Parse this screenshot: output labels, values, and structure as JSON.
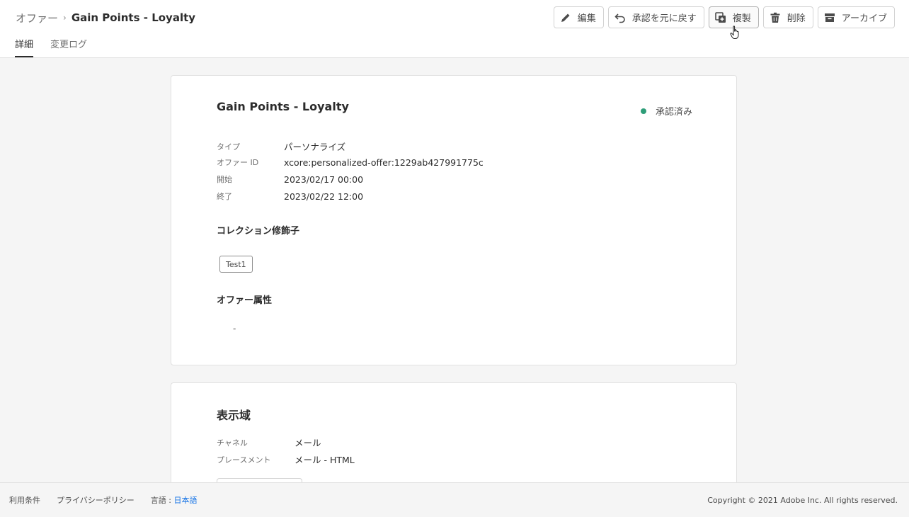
{
  "header": {
    "breadcrumb": {
      "parent": "オファー",
      "separator": "›",
      "current": "Gain Points - Loyalty"
    },
    "tabs": [
      {
        "label": "詳細",
        "active": true
      },
      {
        "label": "変更ログ",
        "active": false
      }
    ],
    "toolbar": {
      "edit": {
        "label": "編集",
        "icon": "pencil-icon"
      },
      "revert": {
        "label": "承認を元に戻す",
        "icon": "undo-icon"
      },
      "duplicate": {
        "label": "複製",
        "icon": "duplicate-icon"
      },
      "delete": {
        "label": "削除",
        "icon": "trash-icon"
      },
      "archive": {
        "label": "アーカイブ",
        "icon": "archive-icon"
      }
    }
  },
  "offer": {
    "title": "Gain Points - Loyalty",
    "status": {
      "label": "承認済み",
      "color": "#2d9d78"
    },
    "fields": [
      {
        "label": "タイプ",
        "value": "パーソナライズ"
      },
      {
        "label": "オファー ID",
        "value": "xcore:personalized-offer:1229ab427991775c"
      },
      {
        "label": "開始",
        "value": "2023/02/17 00:00"
      },
      {
        "label": "終了",
        "value": "2023/02/22 12:00"
      }
    ],
    "collection_qualifiers": {
      "title": "コレクション修飾子",
      "tags": [
        "Test1"
      ]
    },
    "attributes": {
      "title": "オファー属性",
      "value": "-"
    }
  },
  "representation": {
    "title": "表示域",
    "fields": [
      {
        "label": "チャネル",
        "value": "メール"
      },
      {
        "label": "プレースメント",
        "value": "メール - HTML"
      }
    ]
  },
  "footer": {
    "terms": "利用条件",
    "privacy": "プライバシーポリシー",
    "language_label": "言語 :",
    "language_value": "日本語",
    "copyright": "Copyright © 2021 Adobe Inc. All rights reserved."
  },
  "colors": {
    "accent": "#1473e6",
    "approved": "#2d9d78"
  }
}
